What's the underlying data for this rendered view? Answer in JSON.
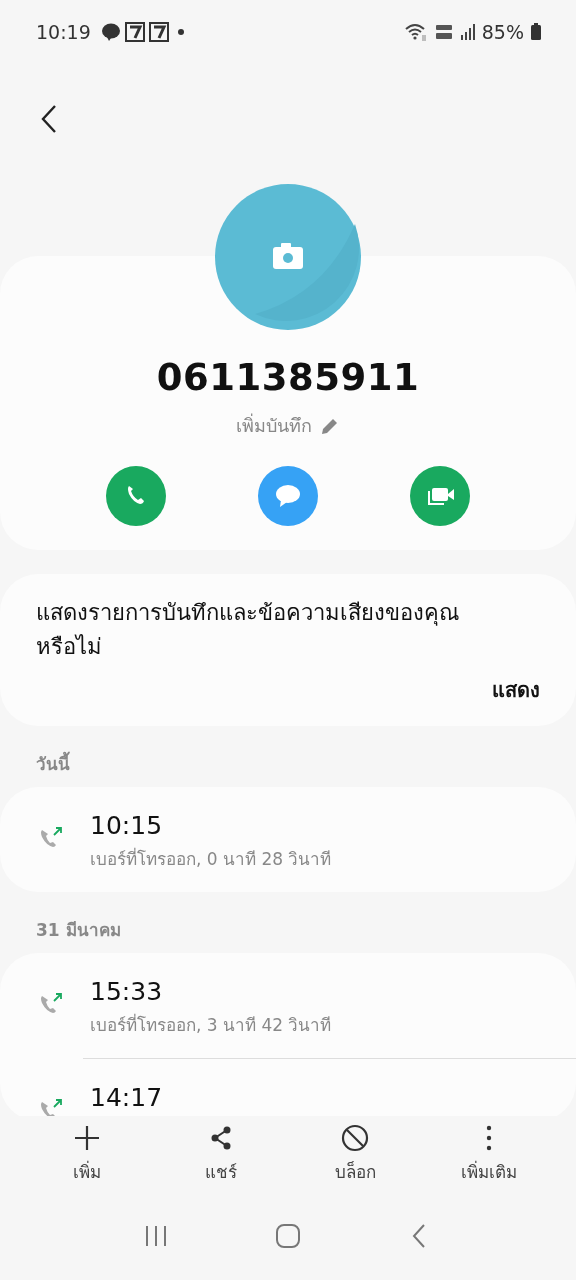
{
  "status_bar": {
    "time": "10:19",
    "battery": "85%"
  },
  "contact": {
    "number": "0611385911",
    "note_action": "เพิ่มบันทึก"
  },
  "quick_actions": [
    {
      "kind": "call"
    },
    {
      "kind": "message"
    },
    {
      "kind": "video"
    }
  ],
  "prompt": {
    "text": "แสดงรายการบันทึกและข้อความเสียงของคุณหรือไม่",
    "button": "แสดง"
  },
  "call_groups": [
    {
      "date": "วันนี้",
      "calls": [
        {
          "time": "10:15",
          "detail": "เบอร์ที่โทรออก, 0 นาที 28 วินาที"
        }
      ]
    },
    {
      "date": "31 มีนาคม",
      "calls": [
        {
          "time": "15:33",
          "detail": "เบอร์ที่โทรออก, 3 นาที 42 วินาที"
        },
        {
          "time": "14:17"
        }
      ]
    }
  ],
  "bottom_actions": [
    {
      "kind": "add",
      "label": "เพิ่ม"
    },
    {
      "kind": "share",
      "label": "แชร์"
    },
    {
      "kind": "block",
      "label": "บล็อก"
    },
    {
      "kind": "more",
      "label": "เพิ่มเติม"
    }
  ]
}
